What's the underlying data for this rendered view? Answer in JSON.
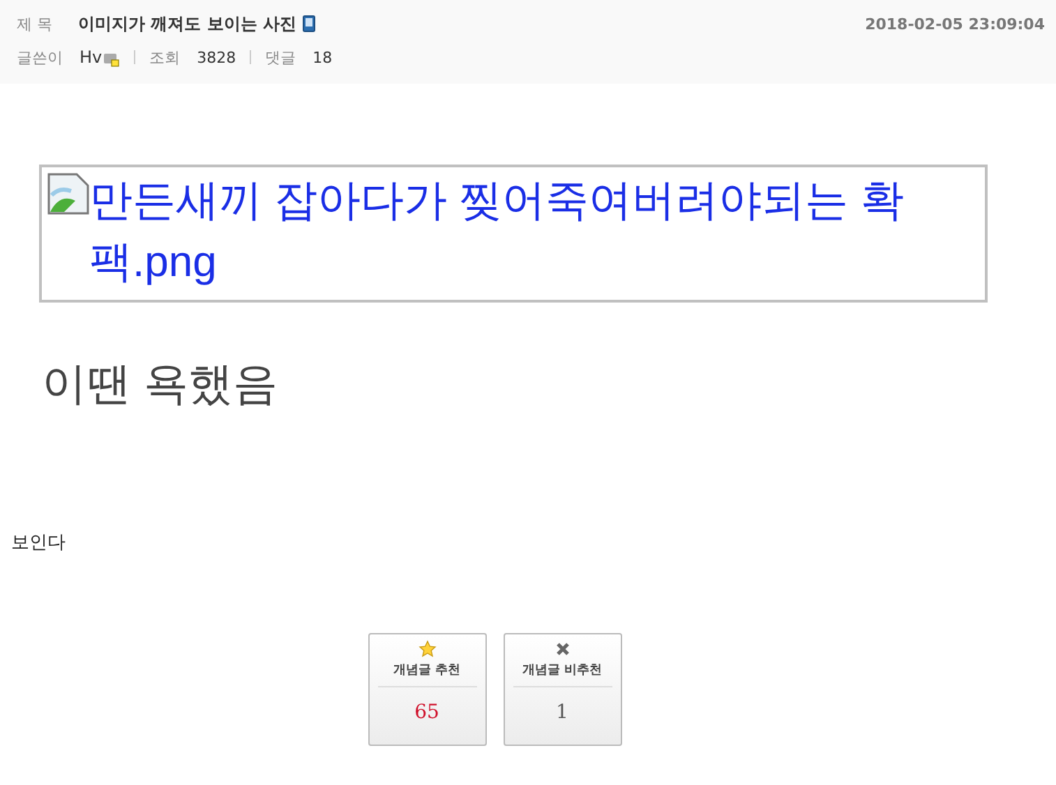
{
  "post": {
    "title_label": "제 목",
    "title": "이미지가 깨져도 보이는 사진",
    "date": "2018-02-05 23:09:04",
    "meta": [
      {
        "label": "글쓴이",
        "value": "Hv",
        "kind": "author"
      },
      {
        "label": "조회",
        "value": "3828",
        "kind": "plain"
      },
      {
        "label": "댓글",
        "value": "18",
        "kind": "plain"
      }
    ]
  },
  "body": {
    "broken_image_alt": "만든새끼 잡아다가 찢어죽여버려야되는 확팩.png",
    "heading": "이땐 욕했음",
    "text": "보인다"
  },
  "votes": [
    {
      "kind": "up",
      "label": "개념글 추천",
      "count": "65"
    },
    {
      "kind": "down",
      "label": "개념글 비추천",
      "count": "1"
    }
  ]
}
